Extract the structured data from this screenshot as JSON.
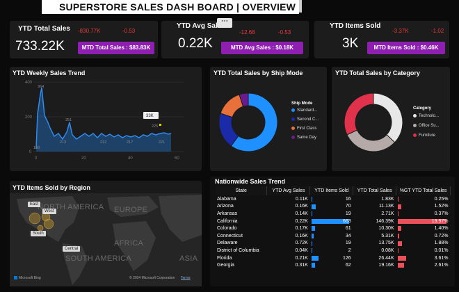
{
  "header": {
    "title": "SUPERSTORE SALES DASH BOARD | OVERVIEW"
  },
  "kpis": [
    {
      "label": "YTD Total Sales",
      "value": "733.22K",
      "delta_value": "-830.77K",
      "delta_pct": "-0.53",
      "mtd": "MTD Total Sales : $83.83K"
    },
    {
      "label": "YTD Avg Sales",
      "value": "0.22K",
      "delta_value": "-12.68",
      "delta_pct": "-0.53",
      "mtd": "MTD Avg Sales : $0.18K"
    },
    {
      "label": "YTD Items Sold",
      "value": "3K",
      "delta_value": "-3.37K",
      "delta_pct": "-1.02",
      "mtd": "MTD Items Sold : $0.46K"
    }
  ],
  "more_options": "⋯",
  "weekly": {
    "title": "YTD Weekly Sales Trend",
    "y_ticks": [
      "400",
      "200",
      "0"
    ],
    "x_ticks": [
      "0",
      "20",
      "40",
      "60"
    ],
    "annotations": [
      "364",
      "251",
      "213",
      "212",
      "217",
      "221",
      "198",
      "225"
    ],
    "badge": "33K"
  },
  "shipmode": {
    "title": "YTD Total Sales by Ship Mode",
    "legend_title": "Ship Mode",
    "items": [
      {
        "label": "Standard...",
        "color": "#1e90ff",
        "share": 0.6
      },
      {
        "label": "Second C...",
        "color": "#1a2aa8",
        "share": 0.2
      },
      {
        "label": "First Class",
        "color": "#e8703a",
        "share": 0.15
      },
      {
        "label": "Same Day",
        "color": "#6a1b8f",
        "share": 0.05
      }
    ]
  },
  "category": {
    "title": "YTD Total Sales by Category",
    "legend_title": "Category",
    "items": [
      {
        "label": "Technolo...",
        "color": "#e8e8e8",
        "share": 0.37
      },
      {
        "label": "Office Su...",
        "color": "#b5aaa8",
        "share": 0.31
      },
      {
        "label": "Furniture",
        "color": "#e0324a",
        "share": 0.32
      }
    ]
  },
  "region": {
    "title": "YTD Items Sold by Region",
    "continents": [
      "NORTH AMERICA",
      "EUROPE",
      "AFRICA",
      "SOUTH AMERICA",
      "ASIA"
    ],
    "tags": [
      "East",
      "West",
      "South",
      "Central"
    ],
    "attribution": "© 2024 Microsoft Corporation",
    "terms": "Terms",
    "brand": "Microsoft Bing"
  },
  "table": {
    "title": "Nationwide Sales Trend",
    "headers": [
      "State",
      "YTD Avg Sales",
      "YTD Items Sold",
      "YTD Total Sales",
      "%GT YTD Total Sales"
    ],
    "rows": [
      {
        "state": "Alabama",
        "avg": "0.11K",
        "items": "16",
        "total": "1.83K",
        "pct": "0.25%",
        "items_n": 16,
        "pct_n": 0.25
      },
      {
        "state": "Arizona",
        "avg": "0.16K",
        "items": "70",
        "total": "11.13K",
        "pct": "1.52%",
        "items_n": 70,
        "pct_n": 1.52
      },
      {
        "state": "Arkansas",
        "avg": "0.14K",
        "items": "19",
        "total": "2.71K",
        "pct": "0.37%",
        "items_n": 19,
        "pct_n": 0.37
      },
      {
        "state": "California",
        "avg": "0.22K",
        "items": "663",
        "total": "146.39K",
        "pct": "19.97%",
        "items_n": 663,
        "pct_n": 19.97
      },
      {
        "state": "Colorado",
        "avg": "0.17K",
        "items": "61",
        "total": "10.30K",
        "pct": "1.40%",
        "items_n": 61,
        "pct_n": 1.4
      },
      {
        "state": "Connecticut",
        "avg": "0.16K",
        "items": "34",
        "total": "5.31K",
        "pct": "0.72%",
        "items_n": 34,
        "pct_n": 0.72
      },
      {
        "state": "Delaware",
        "avg": "0.72K",
        "items": "19",
        "total": "13.75K",
        "pct": "1.88%",
        "items_n": 19,
        "pct_n": 1.88
      },
      {
        "state": "District of Columbia",
        "avg": "0.04K",
        "items": "2",
        "total": "0.08K",
        "pct": "0.01%",
        "items_n": 2,
        "pct_n": 0.01
      },
      {
        "state": "Florida",
        "avg": "0.21K",
        "items": "126",
        "total": "26.44K",
        "pct": "3.61%",
        "items_n": 126,
        "pct_n": 3.61
      },
      {
        "state": "Georgia",
        "avg": "0.31K",
        "items": "62",
        "total": "19.16K",
        "pct": "2.61%",
        "items_n": 62,
        "pct_n": 2.61
      }
    ]
  }
}
